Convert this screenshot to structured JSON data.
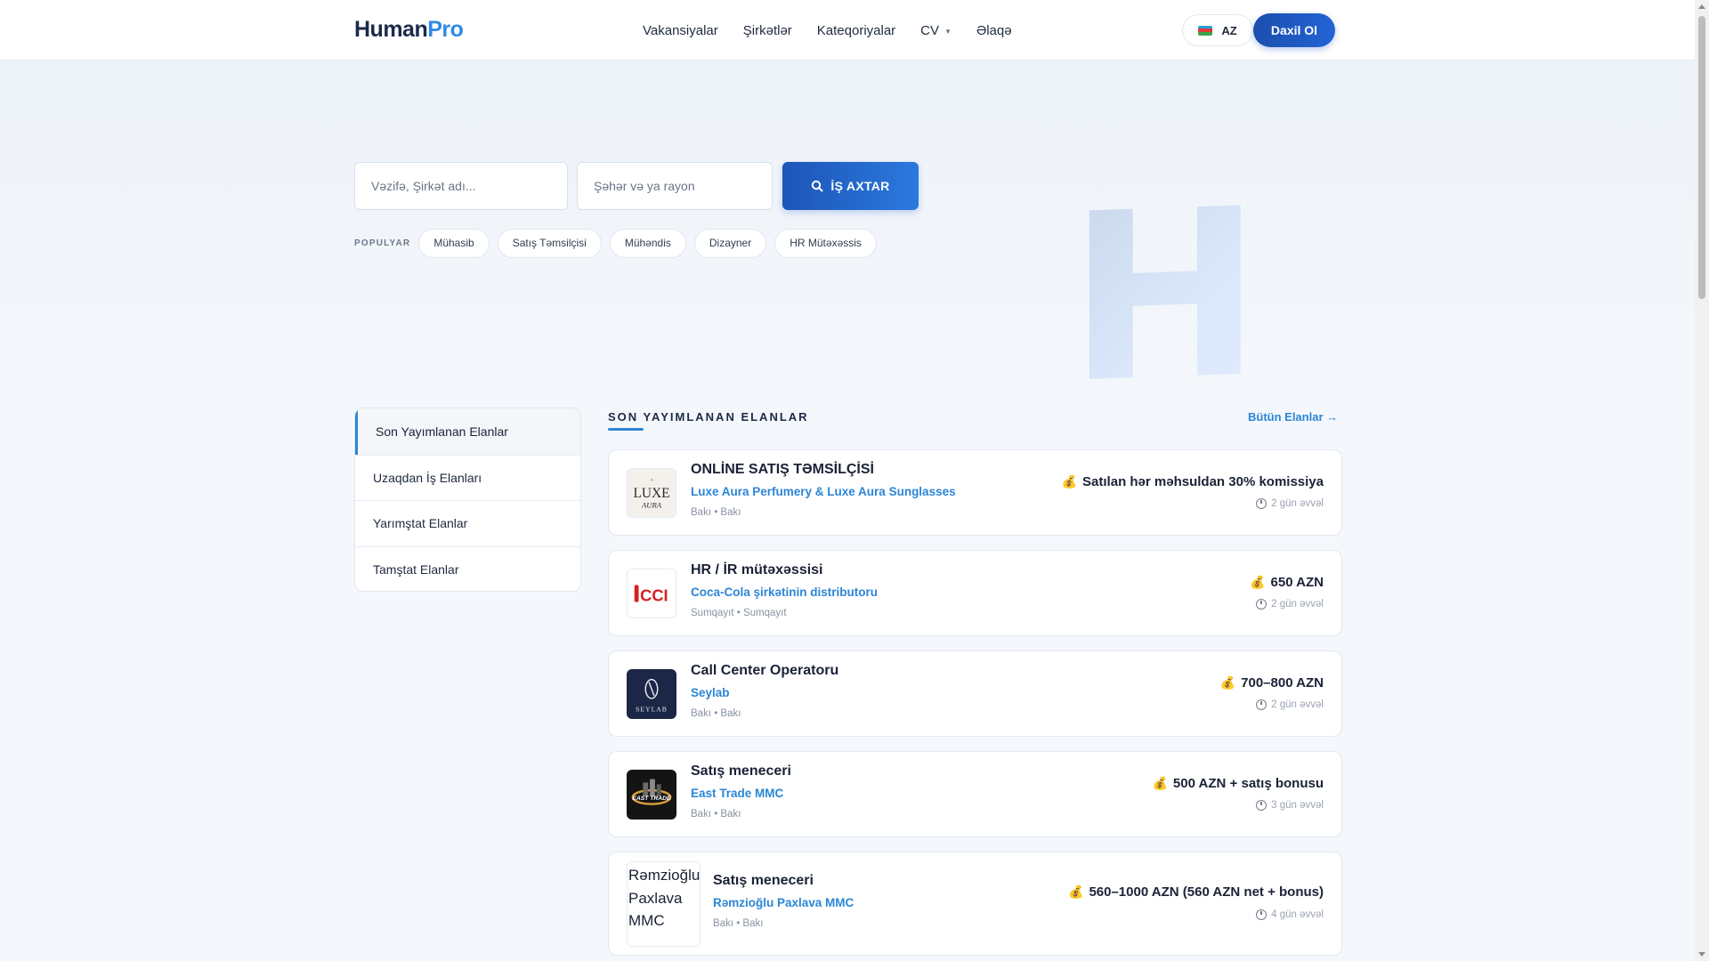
{
  "header": {
    "logo_part1": "Human",
    "logo_part2": "Pro",
    "nav": [
      "Vakansiyalar",
      "Şirkətlər",
      "Kateqoriyalar",
      "CV",
      "Əlaqə"
    ],
    "lang": "AZ",
    "login": "Daxil Ol"
  },
  "hero": {
    "decor_letter": "H",
    "search_placeholder": "Vəzifə, Şirkət adı...",
    "city_placeholder": "Şəhər və ya rayon",
    "search_button": "İŞ AXTAR",
    "popular_label": "POPULYAR",
    "popular_tags": [
      "Mühasib",
      "Satış Təmsilçisi",
      "Mühəndis",
      "Dizayner",
      "HR Mütəxəssis"
    ]
  },
  "sidebar": {
    "items": [
      "Son Yayımlanan Elanlar",
      "Uzaqdan İş Elanları",
      "Yarımştat Elanlar",
      "Tamştat Elanlar"
    ],
    "active": 0
  },
  "listing": {
    "title": "SON YAYIMLANAN ELANLAR",
    "all_link": "Bütün Elanlar →",
    "jobs": [
      {
        "title": "ONLİNE SATIŞ TƏMSİLÇİSİ",
        "company": "Luxe Aura Perfumery & Luxe Aura Sunglasses",
        "location": "Bakı • Bakı",
        "salary": "Satılan hər məhsuldan 30% komissiya",
        "posted": "2 gün əvvəl",
        "logo_text": "LUXE AURA"
      },
      {
        "title": "HR / İR mütəxəssisi",
        "company": "Coca-Cola şirkətinin distributoru",
        "location": "Sumqayıt • Sumqayıt",
        "salary": "650 AZN",
        "posted": "2 gün əvvəl",
        "logo_text": "CCI"
      },
      {
        "title": "Call Center Operatoru",
        "company": "Seylab",
        "location": "Bakı • Bakı",
        "salary": "700–800 AZN",
        "posted": "2 gün əvvəl",
        "logo_text": "SEYLAB"
      },
      {
        "title": "Satış meneceri",
        "company": "East Trade MMC",
        "location": "Bakı • Bakı",
        "salary": "500 AZN + satış bonusu",
        "posted": "3 gün əvvəl",
        "logo_text": "EAST TRADE"
      },
      {
        "title": "Satış meneceri",
        "company": "Rəmzioğlu Paxlava MMC",
        "location": "Bakı • Bakı",
        "salary": "560–1000 AZN (560 AZN net + bonus)",
        "posted": "4 gün əvvəl",
        "logo_text": "Rəmzioğlu Paxlava MMC"
      }
    ]
  },
  "colors": {
    "accent": "#2b86d6",
    "primary_button": "#1d55b8",
    "text_dark": "#1a2236"
  }
}
